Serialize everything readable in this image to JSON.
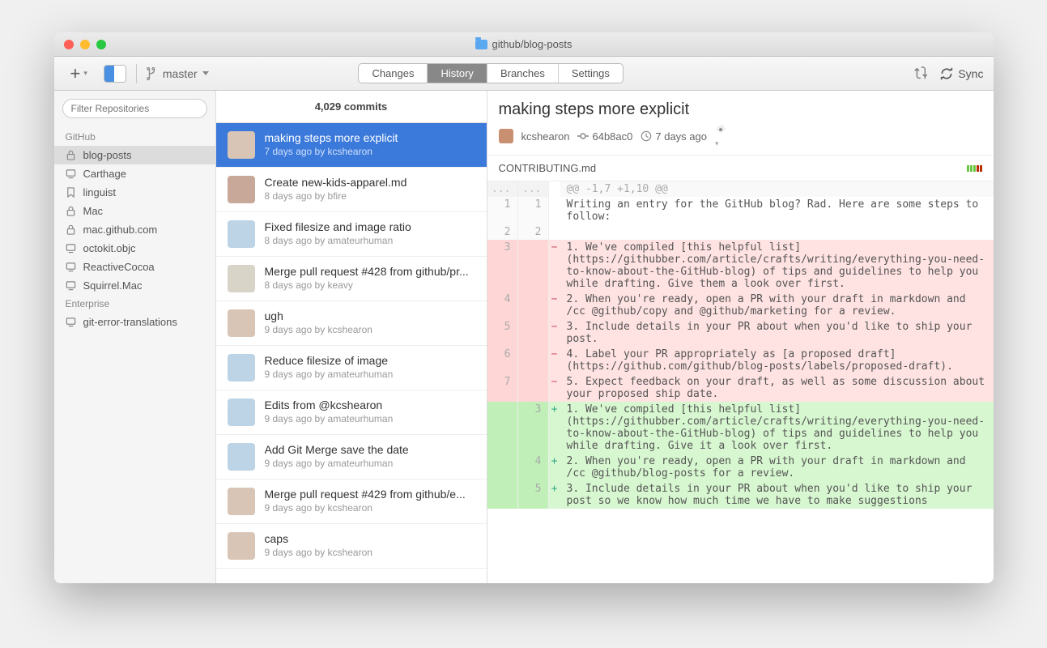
{
  "window": {
    "title": "github/blog-posts"
  },
  "toolbar": {
    "branch": "master",
    "tabs": [
      "Changes",
      "History",
      "Branches",
      "Settings"
    ],
    "active_tab": "History",
    "sync_label": "Sync"
  },
  "sidebar": {
    "filter_placeholder": "Filter Repositories",
    "groups": [
      {
        "label": "GitHub",
        "items": [
          {
            "name": "blog-posts",
            "icon": "lock",
            "selected": true
          },
          {
            "name": "Carthage",
            "icon": "device"
          },
          {
            "name": "linguist",
            "icon": "bookmark"
          },
          {
            "name": "Mac",
            "icon": "lock"
          },
          {
            "name": "mac.github.com",
            "icon": "lock"
          },
          {
            "name": "octokit.objc",
            "icon": "device"
          },
          {
            "name": "ReactiveCocoa",
            "icon": "device"
          },
          {
            "name": "Squirrel.Mac",
            "icon": "device"
          }
        ]
      },
      {
        "label": "Enterprise",
        "items": [
          {
            "name": "git-error-translations",
            "icon": "device"
          }
        ]
      }
    ]
  },
  "commits": {
    "count_label": "4,029 commits",
    "items": [
      {
        "title": "making steps more explicit",
        "meta": "7 days ago by kcshearon",
        "avatar": "#d8c5b5",
        "selected": true
      },
      {
        "title": "Create new-kids-apparel.md",
        "meta": "8 days ago by bfire",
        "avatar": "#c8a898"
      },
      {
        "title": "Fixed filesize and image ratio",
        "meta": "8 days ago by amateurhuman",
        "avatar": "#bcd4e6"
      },
      {
        "title": "Merge pull request #428 from github/pr...",
        "meta": "8 days ago by keavy",
        "avatar": "#d8d4c8"
      },
      {
        "title": "ugh",
        "meta": "9 days ago by kcshearon",
        "avatar": "#d8c5b5"
      },
      {
        "title": "Reduce filesize of image",
        "meta": "9 days ago by amateurhuman",
        "avatar": "#bcd4e6"
      },
      {
        "title": "Edits from @kcshearon",
        "meta": "9 days ago by amateurhuman",
        "avatar": "#bcd4e6"
      },
      {
        "title": "Add Git Merge save the date",
        "meta": "9 days ago by amateurhuman",
        "avatar": "#bcd4e6"
      },
      {
        "title": "Merge pull request #429 from github/e...",
        "meta": "9 days ago by kcshearon",
        "avatar": "#d8c5b5"
      },
      {
        "title": "caps",
        "meta": "9 days ago by kcshearon",
        "avatar": "#d8c5b5"
      }
    ]
  },
  "detail": {
    "title": "making steps more explicit",
    "author": "kcshearon",
    "sha": "64b8ac0",
    "time": "7 days ago",
    "file": "CONTRIBUTING.md",
    "hunk": "@@ -1,7 +1,10 @@",
    "diff": [
      {
        "old": "1",
        "new": "1",
        "type": "ctx",
        "text": "Writing an entry for the GitHub blog? Rad. Here are some steps to follow:"
      },
      {
        "old": "2",
        "new": "2",
        "type": "ctx",
        "text": ""
      },
      {
        "old": "3",
        "new": "",
        "type": "del",
        "text": "1. We've compiled [this helpful list](https://githubber.com/article/crafts/writing/everything-you-need-to-know-about-the-GitHub-blog) of tips and guidelines to help you while drafting. Give them a look over first."
      },
      {
        "old": "4",
        "new": "",
        "type": "del",
        "text": "2. When you're ready, open a PR with your draft in markdown and /cc @github/copy and @github/marketing for a review."
      },
      {
        "old": "5",
        "new": "",
        "type": "del",
        "text": "3. Include details in your PR about when you'd like to ship your post."
      },
      {
        "old": "6",
        "new": "",
        "type": "del",
        "text": "4. Label your PR appropriately as [a proposed draft](https://github.com/github/blog-posts/labels/proposed-draft)."
      },
      {
        "old": "7",
        "new": "",
        "type": "del",
        "text": "5. Expect feedback on your draft, as well as some discussion about your proposed ship date."
      },
      {
        "old": "",
        "new": "3",
        "type": "add",
        "text": "1. We've compiled [this helpful list](https://githubber.com/article/crafts/writing/everything-you-need-to-know-about-the-GitHub-blog) of tips and guidelines to help you while drafting. Give it a look over first."
      },
      {
        "old": "",
        "new": "4",
        "type": "add",
        "text": "2. When you're ready, open a PR with your draft in markdown and /cc @github/blog-posts for a review."
      },
      {
        "old": "",
        "new": "5",
        "type": "add",
        "text": "3. Include details in your PR about when you'd like to ship your post so we know how much time we have to make suggestions"
      }
    ],
    "diffstat_colors": [
      "#6cc644",
      "#6cc644",
      "#6cc644",
      "#bd2c00",
      "#bd2c00"
    ]
  }
}
